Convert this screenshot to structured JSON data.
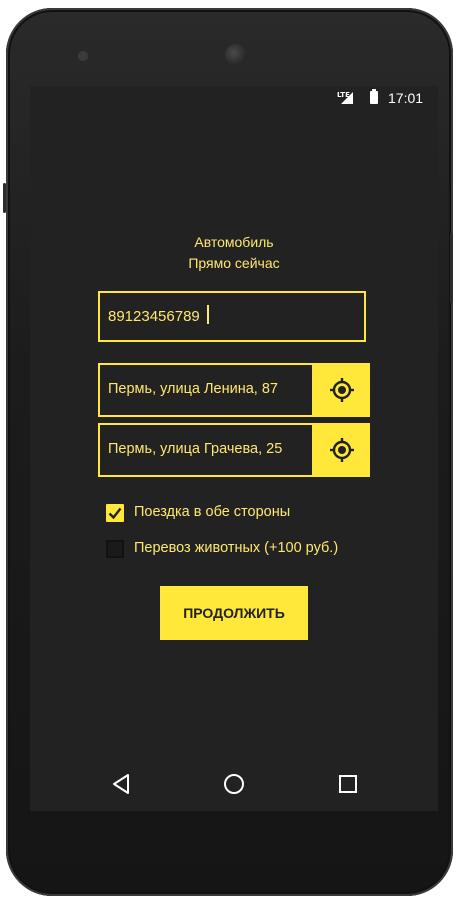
{
  "status_bar": {
    "network": "LTE",
    "time": "17:01"
  },
  "header": {
    "line1": "Автомобиль",
    "line2": "Прямо сейчас"
  },
  "phone_input": {
    "value": "89123456789"
  },
  "addresses": [
    {
      "text": "Пермь, улица Ленина, 87",
      "button_icon": "gps-locate-icon"
    },
    {
      "text": "Пермь, улица Грачева, 25",
      "button_icon": "gps-locate-icon"
    }
  ],
  "options": [
    {
      "label": "Поездка в обе стороны",
      "checked": true
    },
    {
      "label": "Перевоз животных (+100 руб.)",
      "checked": false
    }
  ],
  "continue_button": {
    "label": "ПРОДОЛЖИТЬ"
  },
  "navigation": {
    "icons": [
      "back-icon",
      "home-icon",
      "recents-icon"
    ]
  },
  "colors": {
    "accent": "#ffe83a",
    "text": "#ffe86e",
    "background": "#222222"
  }
}
